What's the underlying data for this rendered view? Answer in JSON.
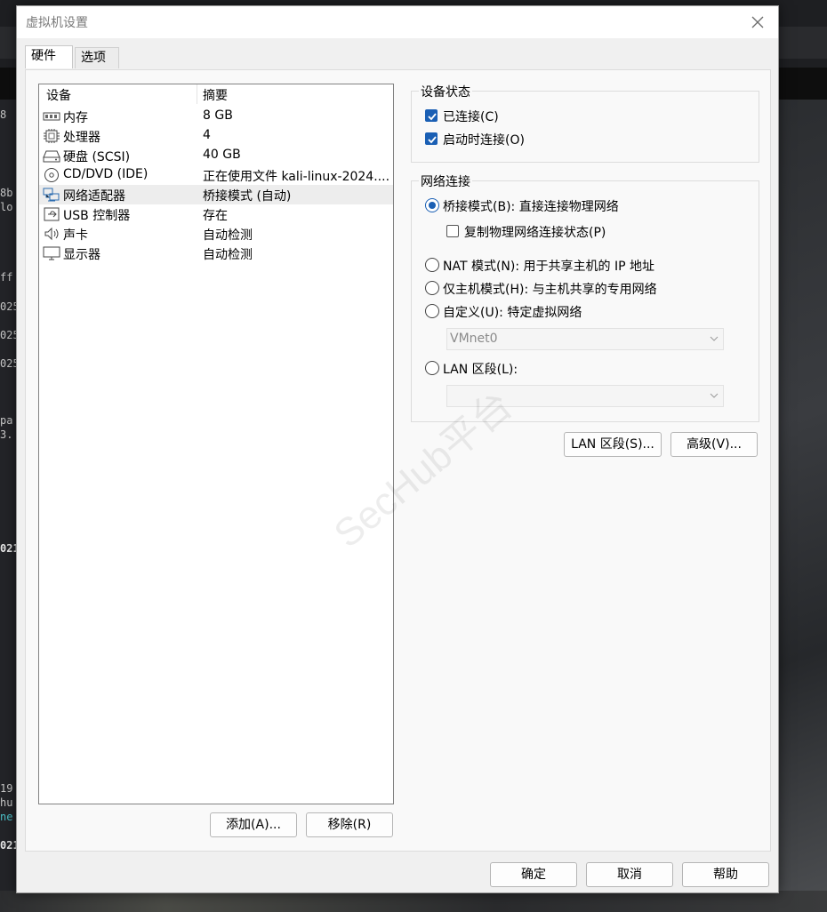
{
  "background_terminal": {
    "fragments": [
      "8",
      "8b",
      "lo",
      "ff",
      "025",
      "025",
      "025",
      "pa",
      "3.",
      "021",
      "19",
      "hu",
      "ne",
      "021"
    ]
  },
  "dialog": {
    "title": "虚拟机设置",
    "tabs": [
      {
        "label": "硬件",
        "active": true
      },
      {
        "label": "选项",
        "active": false
      }
    ],
    "device_list": {
      "columns": [
        "设备",
        "摘要"
      ],
      "rows": [
        {
          "icon": "memory-icon",
          "name": "内存",
          "summary": "8 GB"
        },
        {
          "icon": "processor-icon",
          "name": "处理器",
          "summary": "4"
        },
        {
          "icon": "hard-disk-icon",
          "name": "硬盘 (SCSI)",
          "summary": "40 GB"
        },
        {
          "icon": "cd-dvd-icon",
          "name": "CD/DVD (IDE)",
          "summary": "正在使用文件 kali-linux-2024...."
        },
        {
          "icon": "network-adapter-icon",
          "name": "网络适配器",
          "summary": "桥接模式 (自动)",
          "selected": true
        },
        {
          "icon": "usb-icon",
          "name": "USB 控制器",
          "summary": "存在"
        },
        {
          "icon": "sound-card-icon",
          "name": "声卡",
          "summary": "自动检测"
        },
        {
          "icon": "display-icon",
          "name": "显示器",
          "summary": "自动检测"
        }
      ]
    },
    "add_button": "添加(A)...",
    "remove_button": "移除(R)",
    "device_status": {
      "label": "设备状态",
      "connected": {
        "label": "已连接(C)",
        "checked": true
      },
      "connect_at_power_on": {
        "label": "启动时连接(O)",
        "checked": true
      }
    },
    "network_connection": {
      "label": "网络连接",
      "bridged": {
        "label": "桥接模式(B): 直接连接物理网络",
        "selected": true
      },
      "replicate_state": {
        "label": "复制物理网络连接状态(P)",
        "checked": false
      },
      "nat": {
        "label": "NAT 模式(N): 用于共享主机的 IP 地址",
        "selected": false
      },
      "host_only": {
        "label": "仅主机模式(H): 与主机共享的专用网络",
        "selected": false
      },
      "custom": {
        "label": "自定义(U): 特定虚拟网络",
        "selected": false
      },
      "custom_select_value": "VMnet0",
      "lan_segment": {
        "label": "LAN 区段(L):",
        "selected": false
      },
      "lan_select_value": ""
    },
    "lan_segments_button": "LAN 区段(S)...",
    "advanced_button": "高级(V)...",
    "ok_button": "确定",
    "cancel_button": "取消",
    "help_button": "帮助",
    "watermark": "SecHub平台",
    "accent_color": "#1a5fb4"
  }
}
